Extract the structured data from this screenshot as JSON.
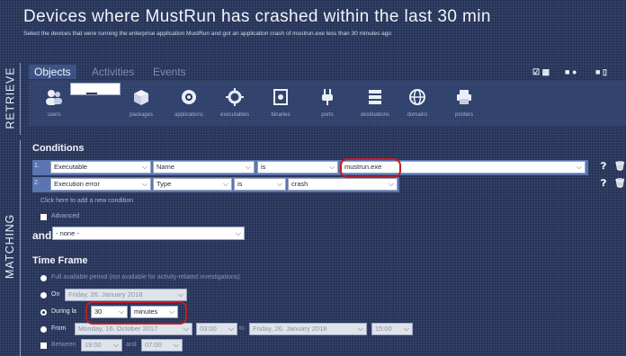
{
  "header": {
    "title": "Devices where MustRun has crashed within the last 30 min",
    "subtitle": "Select the devices that were running the enterprise application MustRun and got an application crash of mustrun.exe less than 30 minutes ago"
  },
  "side_labels": {
    "retrieve": "RETRIEVE",
    "matching": "MATCHING"
  },
  "tabs": [
    {
      "label": "Objects",
      "active": true
    },
    {
      "label": "Activities",
      "active": false
    },
    {
      "label": "Events",
      "active": false
    }
  ],
  "categories": [
    {
      "label": "users",
      "icon": "users-icon"
    },
    {
      "label": "devices",
      "icon": "monitor-icon",
      "selected": true
    },
    {
      "label": "packages",
      "icon": "package-icon"
    },
    {
      "label": "applications",
      "icon": "application-icon"
    },
    {
      "label": "executables",
      "icon": "gear-icon"
    },
    {
      "label": "binaries",
      "icon": "binary-icon"
    },
    {
      "label": "ports",
      "icon": "plug-icon"
    },
    {
      "label": "destinations",
      "icon": "server-icon"
    },
    {
      "label": "domains",
      "icon": "globe-icon"
    },
    {
      "label": "printers",
      "icon": "printer-icon"
    }
  ],
  "conditions": {
    "title": "Conditions",
    "rows": [
      {
        "index": "1.",
        "object": "Executable",
        "field": "Name",
        "operator": "is",
        "value": "mustrun.exe"
      },
      {
        "index": "2.",
        "object": "Execution error",
        "field": "Type",
        "operator": "is",
        "value": "crash"
      }
    ],
    "add_link": "Click here to add a new condition",
    "advanced": "Advanced",
    "and_label": "and",
    "and_value": "- none -"
  },
  "time_frame": {
    "title": "Time Frame",
    "full_period": "Full available period (not available for activity-related investigations)",
    "on_label": "On",
    "on_date": "Friday, 26. January 2018",
    "during_label": "During la",
    "during_value": "30",
    "during_unit": "minutes",
    "from_label": "From",
    "from_date": "Monday, 16. October 2017",
    "from_time": "03:00",
    "to_label": "to",
    "to_date": "Friday, 26. January 2018",
    "to_time": "15:00",
    "between_label": "Between",
    "between_from": "19:00",
    "and_label": "and",
    "between_to": "07:00"
  },
  "colors": {
    "highlight": "#c11d25",
    "background": "#27345a",
    "row": "#5a75b0"
  }
}
